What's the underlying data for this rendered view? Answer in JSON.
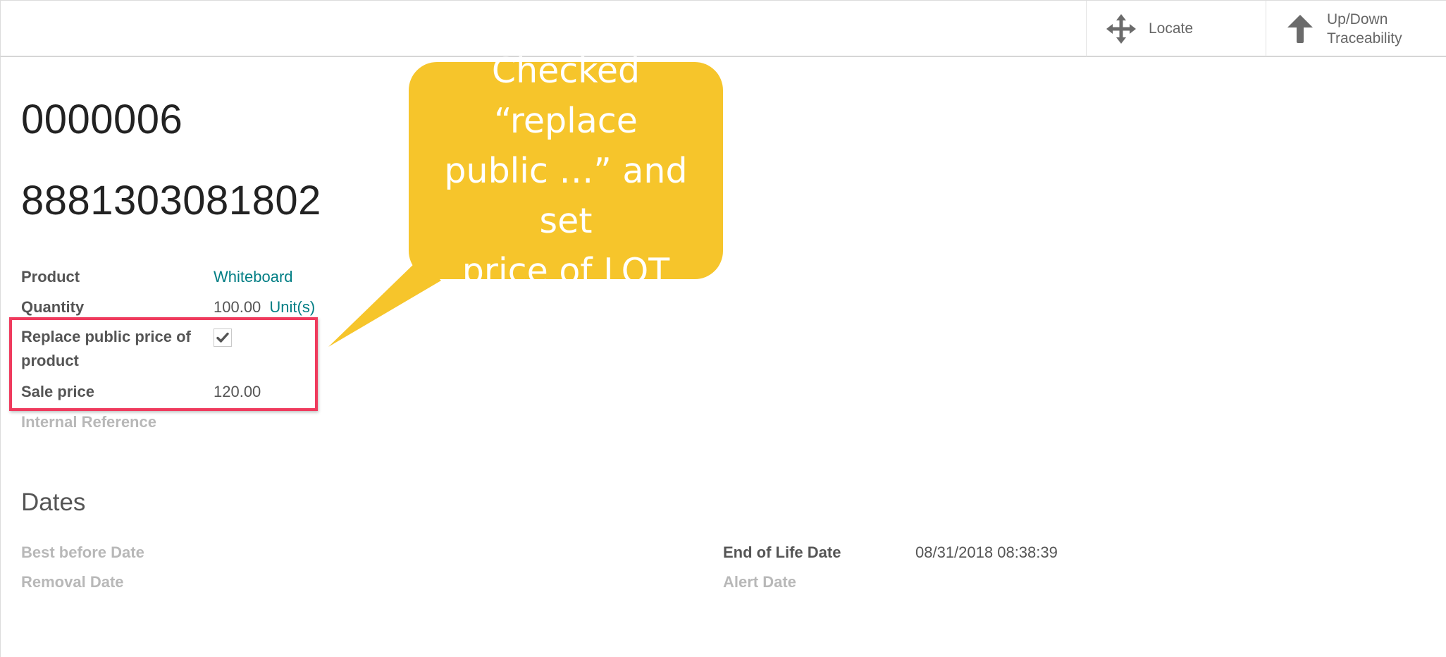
{
  "buttons": {
    "locate": {
      "label": "Locate",
      "icon": "move-arrows-icon"
    },
    "traceability": {
      "label_line1": "Up/Down",
      "label_line2": "Traceability",
      "icon": "arrow-up-icon"
    }
  },
  "record": {
    "lot_name": "0000006",
    "barcode": "8881303081802"
  },
  "fields": {
    "product": {
      "label": "Product",
      "value": "Whiteboard"
    },
    "quantity": {
      "label": "Quantity",
      "value": "100.00",
      "unit": "Unit(s)"
    },
    "replace_price": {
      "label_line1": "Replace public price of",
      "label_line2": "product",
      "checked": true
    },
    "sale_price": {
      "label": "Sale price",
      "value": "120.00"
    },
    "internal_reference": {
      "label": "Internal Reference",
      "value": ""
    }
  },
  "dates": {
    "title": "Dates",
    "best_before": {
      "label": "Best before Date",
      "value": ""
    },
    "removal": {
      "label": "Removal Date",
      "value": ""
    },
    "end_of_life": {
      "label": "End of Life Date",
      "value": "08/31/2018 08:38:39"
    },
    "alert": {
      "label": "Alert Date",
      "value": ""
    }
  },
  "annotation": {
    "line1": "Checked “replace",
    "line2": "public …” and set",
    "line3": "price of LOT"
  },
  "colors": {
    "link": "#017e84",
    "callout": "#f6c52b",
    "highlight": "#ef3a5d"
  }
}
